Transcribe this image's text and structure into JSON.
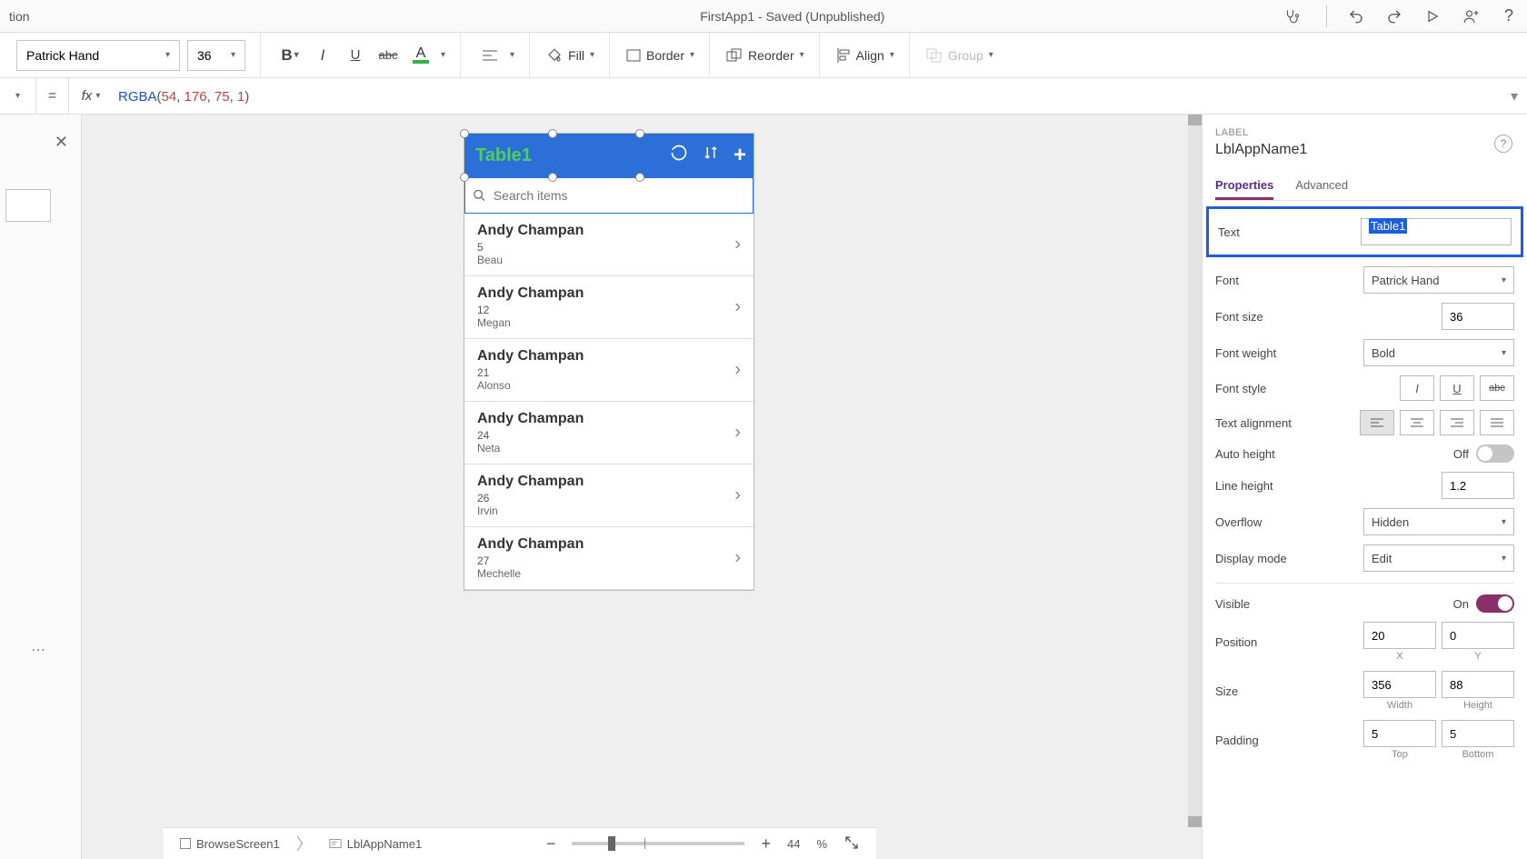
{
  "titlebar": {
    "left_cutoff": "tion",
    "app_title": "FirstApp1 - Saved (Unpublished)"
  },
  "ribbon": {
    "font_name": "Patrick Hand",
    "font_size": "36",
    "fill_label": "Fill",
    "border_label": "Border",
    "reorder_label": "Reorder",
    "align_label": "Align",
    "group_label": "Group"
  },
  "formula": {
    "eq": "=",
    "fx": "fx",
    "fn": "RGBA",
    "args": [
      "54",
      "176",
      "75",
      "1"
    ]
  },
  "phone": {
    "header_text": "Table1",
    "search_placeholder": "Search items",
    "items": [
      {
        "name": "Andy Champan",
        "line1": "5",
        "line2": "Beau"
      },
      {
        "name": "Andy Champan",
        "line1": "12",
        "line2": "Megan"
      },
      {
        "name": "Andy Champan",
        "line1": "21",
        "line2": "Alonso"
      },
      {
        "name": "Andy Champan",
        "line1": "24",
        "line2": "Neta"
      },
      {
        "name": "Andy Champan",
        "line1": "26",
        "line2": "Irvin"
      },
      {
        "name": "Andy Champan",
        "line1": "27",
        "line2": "Mechelle"
      }
    ]
  },
  "props": {
    "category": "LABEL",
    "name": "LblAppName1",
    "tab_properties": "Properties",
    "tab_advanced": "Advanced",
    "lbl_text": "Text",
    "val_text": "Table1",
    "lbl_font": "Font",
    "val_font": "Patrick Hand",
    "lbl_fontsize": "Font size",
    "val_fontsize": "36",
    "lbl_fontweight": "Font weight",
    "val_fontweight": "Bold",
    "lbl_fontstyle": "Font style",
    "lbl_textalign": "Text alignment",
    "lbl_autoheight": "Auto height",
    "val_autoheight": "Off",
    "lbl_lineheight": "Line height",
    "val_lineheight": "1.2",
    "lbl_overflow": "Overflow",
    "val_overflow": "Hidden",
    "lbl_displaymode": "Display mode",
    "val_displaymode": "Edit",
    "lbl_visible": "Visible",
    "val_visible": "On",
    "lbl_position": "Position",
    "val_posx": "20",
    "val_posy": "0",
    "sub_x": "X",
    "sub_y": "Y",
    "lbl_size": "Size",
    "val_w": "356",
    "val_h": "88",
    "sub_w": "Width",
    "sub_h": "Height",
    "lbl_padding": "Padding",
    "val_pad_t": "5",
    "val_pad_b": "5",
    "sub_top": "Top",
    "sub_bottom": "Bottom"
  },
  "status": {
    "crumb1": "BrowseScreen1",
    "crumb2": "LblAppName1",
    "zoom_value": "44",
    "zoom_pct": "%"
  }
}
